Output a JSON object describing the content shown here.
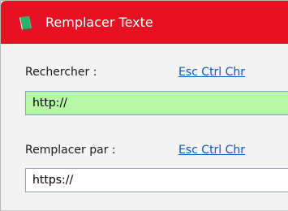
{
  "window": {
    "title": "Remplacer Texte",
    "title_bar_color": "#e81123",
    "icon": "green-book-icon"
  },
  "search": {
    "label": "Rechercher :",
    "special_chars_link": "Esc Ctrl Chr",
    "value": "http://",
    "field_color": "#b5f7a6"
  },
  "replace": {
    "label": "Remplacer par :",
    "special_chars_link": "Esc Ctrl Chr",
    "value": "https://",
    "field_color": "#ffffff"
  }
}
